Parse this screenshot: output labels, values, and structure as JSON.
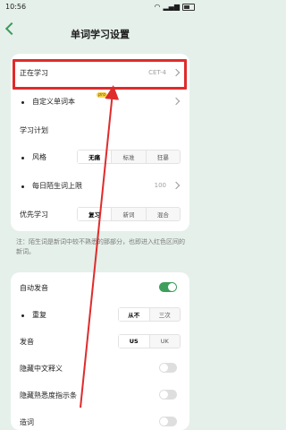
{
  "status": {
    "time": "10:56"
  },
  "header": {
    "title": "单词学习设置"
  },
  "settings": {
    "studying": {
      "label": "正在学习",
      "value": "CET-4"
    },
    "custom_book": {
      "label": "自定义单词本",
      "badge": "pro"
    },
    "plan": {
      "title": "学习计划",
      "style": {
        "label": "风格",
        "options": [
          "无痛",
          "标准",
          "狂暴"
        ],
        "selected": 0
      },
      "daily_new": {
        "label": "每日陌生词上限",
        "value": "100"
      }
    },
    "priority": {
      "label": "优先学习",
      "options": [
        "复习",
        "新词",
        "混合"
      ],
      "selected": 0
    }
  },
  "note": "注：陌生词是新词中较不熟悉的那部分，也即进入红色区间的新词。",
  "audio": {
    "auto_play": {
      "label": "自动发音",
      "on": true
    },
    "repeat": {
      "label": "重复",
      "options": [
        "从不",
        "三次"
      ],
      "selected": 0
    },
    "accent": {
      "label": "发音",
      "options": [
        "US",
        "UK"
      ],
      "selected": 0
    },
    "hide_cn": {
      "label": "隐藏中文释义",
      "on": false
    },
    "hide_familiarity": {
      "label": "隐藏熟悉度指示条",
      "on": false
    },
    "partial": {
      "label": "造词",
      "on": false
    }
  }
}
